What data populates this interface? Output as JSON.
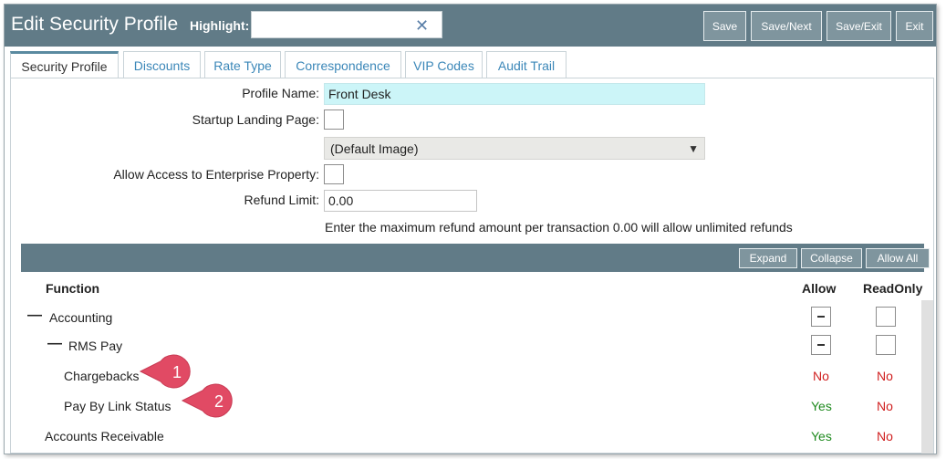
{
  "header": {
    "title": "Edit Security Profile",
    "highlight_label": "Highlight:",
    "highlight_value": "",
    "clear_icon": "close-icon",
    "buttons": [
      "Save",
      "Save/Next",
      "Save/Exit",
      "Exit"
    ]
  },
  "tabs": [
    "Security Profile",
    "Discounts",
    "Rate Type",
    "Correspondence",
    "VIP Codes",
    "Audit Trail"
  ],
  "active_tab": "Security Profile",
  "form": {
    "profile_name_label": "Profile Name:",
    "profile_name_value": "Front Desk",
    "startup_label": "Startup Landing Page:",
    "startup_select": "(Default Image)",
    "enterprise_label": "Allow Access to Enterprise Property:",
    "refund_label": "Refund Limit:",
    "refund_value": "0.00",
    "refund_hint": "Enter the maximum refund amount per transaction 0.00 will allow unlimited refunds"
  },
  "grid": {
    "buttons": [
      "Expand",
      "Collapse",
      "Allow All"
    ],
    "columns": [
      "Function",
      "Allow",
      "ReadOnly"
    ],
    "rows": [
      {
        "label": "Accounting",
        "allow": "",
        "readonly": ""
      },
      {
        "label": "RMS Pay",
        "allow": "",
        "readonly": ""
      },
      {
        "label": "Chargebacks",
        "allow": "No",
        "readonly": "No"
      },
      {
        "label": "Pay By Link Status",
        "allow": "Yes",
        "readonly": "No"
      },
      {
        "label": "Accounts Receivable",
        "allow": "Yes",
        "readonly": "No"
      }
    ],
    "collapse_symbol": "—"
  },
  "callouts": [
    "1",
    "2"
  ],
  "colors": {
    "header": "#617b87",
    "accent": "#e14a64",
    "yes": "#1e8a1e",
    "no": "#d01f1f"
  }
}
